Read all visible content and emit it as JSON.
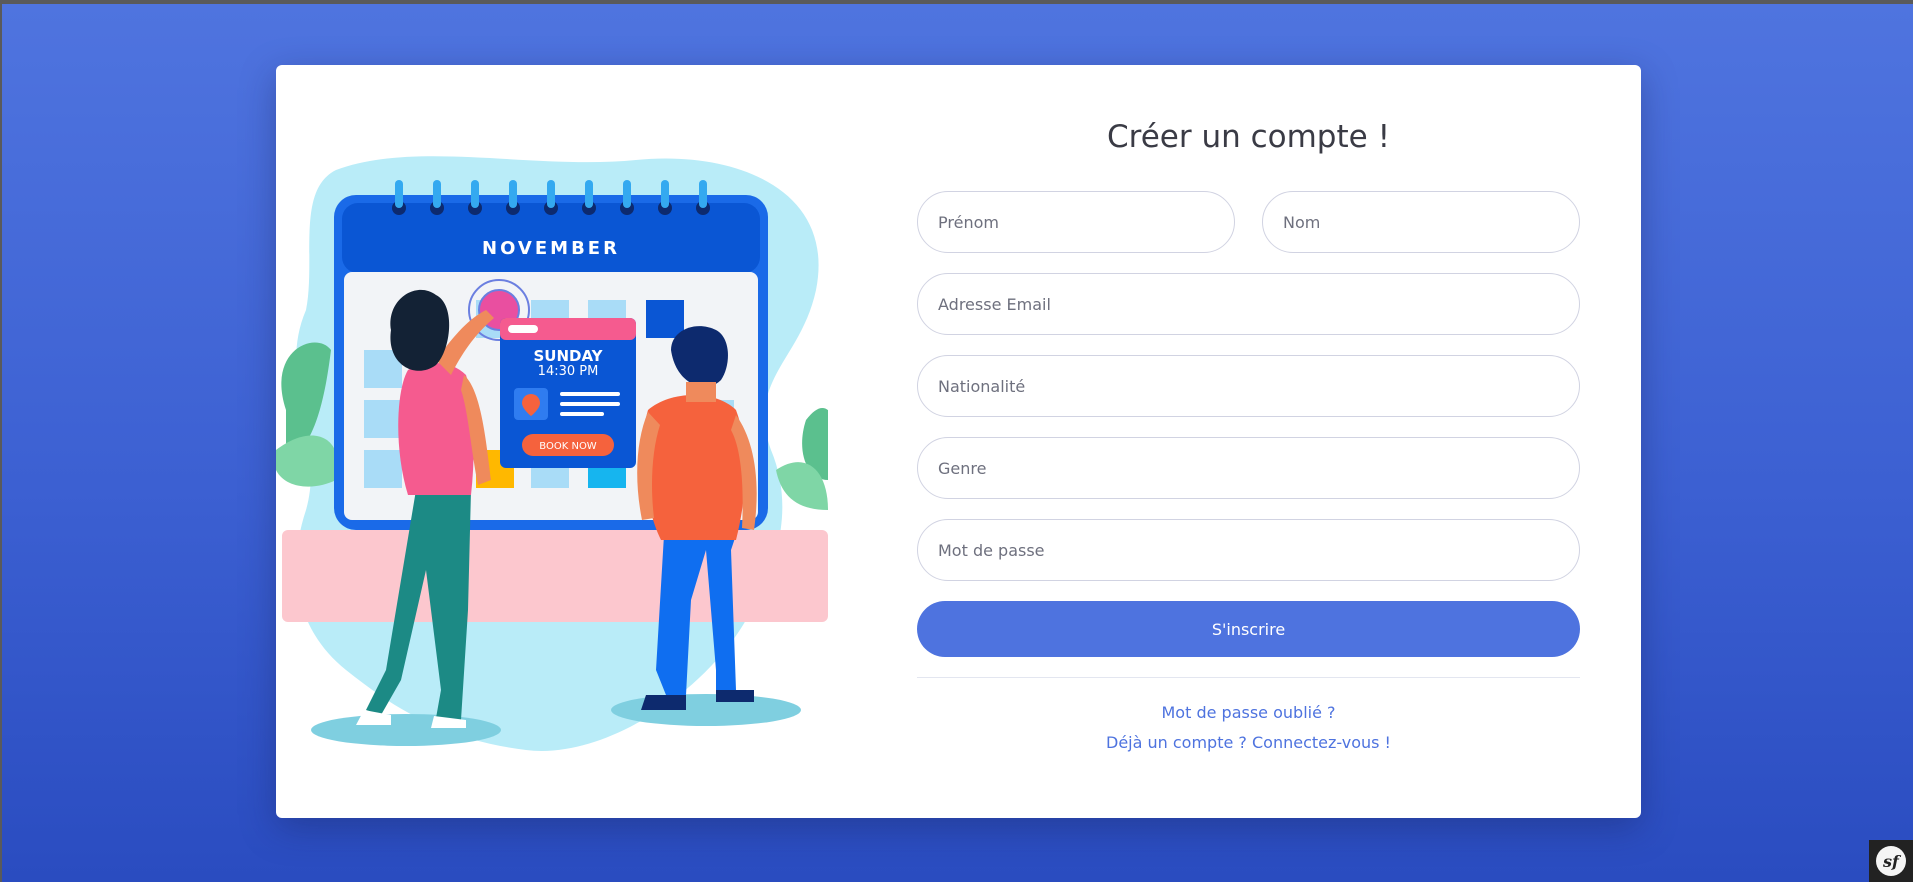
{
  "register": {
    "title": "Créer un compte !",
    "fields": {
      "firstname_placeholder": "Prénom",
      "lastname_placeholder": "Nom",
      "email_placeholder": "Adresse Email",
      "nationality_placeholder": "Nationalité",
      "gender_placeholder": "Genre",
      "password_placeholder": "Mot de passe"
    },
    "submit_label": "S'inscrire",
    "forgot_password_link": "Mot de passe oublié ?",
    "login_link": "Déjà un compte ? Connectez-vous !"
  },
  "illustration": {
    "month": "NOVEMBER",
    "day": "SUNDAY",
    "time": "14:30 PM",
    "cta": "BOOK NOW"
  },
  "debug_toolbar": {
    "icon": "symfony-icon",
    "label": "sf"
  },
  "colors": {
    "background": "#4e73df",
    "accent": "#4e73df",
    "calendar_blue": "#0a56d4"
  }
}
